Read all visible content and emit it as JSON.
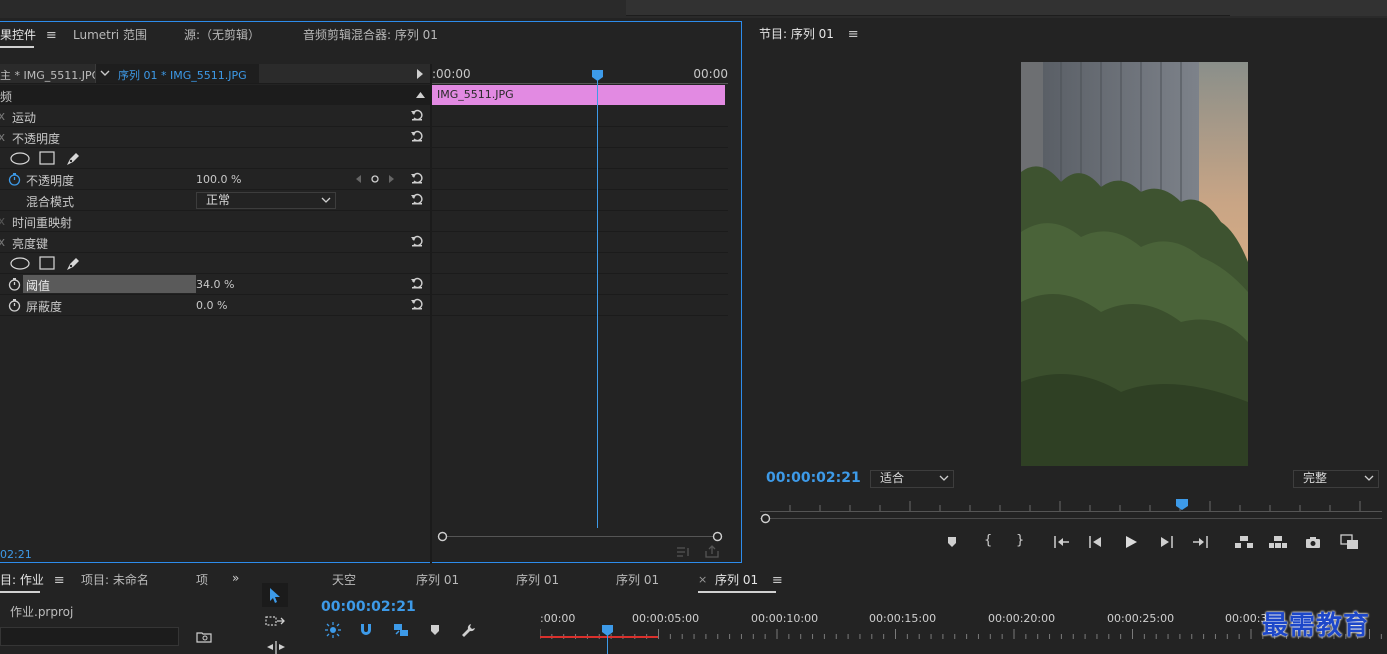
{
  "effect_controls": {
    "tabs": [
      {
        "label": "果控件",
        "active": true
      },
      {
        "label": "Lumetri 范围",
        "active": false
      },
      {
        "label": "源:（无剪辑）",
        "active": false
      },
      {
        "label": "音频剪辑混合器: 序列 01",
        "active": false
      }
    ],
    "source_clip": "主 * IMG_5511.JPG",
    "sequence_clip": "序列 01 * IMG_5511.JPG",
    "section_label": "频",
    "timeline_start": ":00:00",
    "timeline_end": "00:00",
    "clip_bar_label": "IMG_5511.JPG",
    "properties": {
      "motion": "运动",
      "opacity": "不透明度",
      "opacity_param_label": "不透明度",
      "opacity_value": "100.0 %",
      "blend_mode_label": "混合模式",
      "blend_mode_value": "正常",
      "time_remap": "时间重映射",
      "luma_key": "亮度键",
      "threshold_label": "阈值",
      "threshold_value": "34.0 %",
      "cutoff_label": "屏蔽度",
      "cutoff_value": "0.0 %"
    },
    "current_time": "02:21"
  },
  "program_monitor": {
    "title": "节目: 序列 01",
    "timecode": "00:00:02:21",
    "zoom_select": "适合",
    "quality_select": "完整"
  },
  "project_panel": {
    "tabs": [
      {
        "label": "目: 作业",
        "active": true
      },
      {
        "label": "项目: 未命名",
        "active": false
      },
      {
        "label": "项",
        "active": false
      }
    ],
    "file": "作业.prproj"
  },
  "timeline": {
    "tabs": [
      {
        "label": "天空",
        "active": false
      },
      {
        "label": "序列 01",
        "active": false
      },
      {
        "label": "序列 01",
        "active": false
      },
      {
        "label": "序列 01",
        "active": false
      },
      {
        "label": "序列 01",
        "active": true
      }
    ],
    "timecode": "00:00:02:21",
    "ruler": [
      ":00:00",
      "00:00:05:00",
      "00:00:10:00",
      "00:00:15:00",
      "00:00:20:00",
      "00:00:25:00",
      "00:00:3"
    ]
  },
  "watermark": "最需教育",
  "colors": {
    "accent_blue": "#3d9ae8",
    "clip_pink": "#e28ae2",
    "panel_bg": "#232323"
  }
}
